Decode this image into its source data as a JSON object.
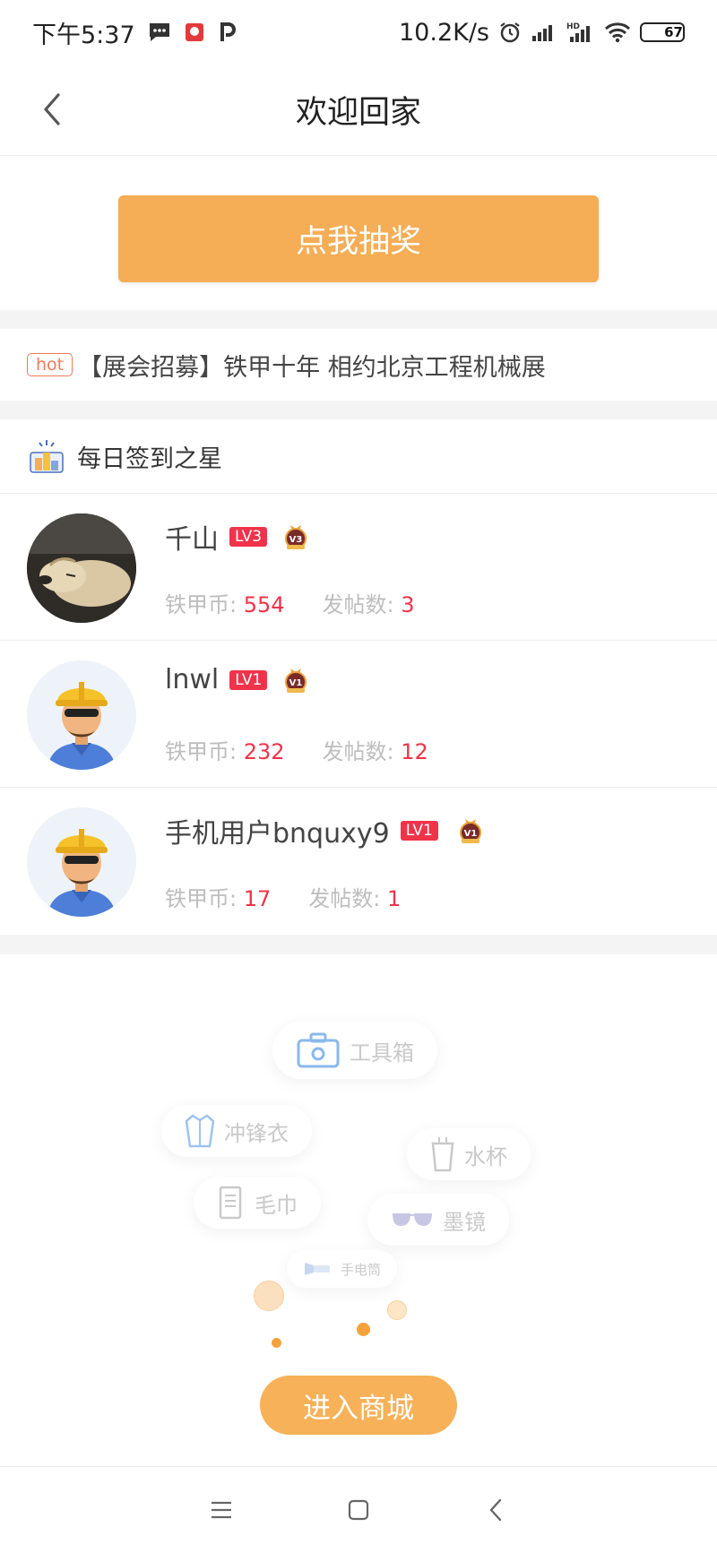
{
  "status_bar": {
    "time": "下午5:37",
    "net_speed": "10.2K/s",
    "battery_level": "67",
    "battery_fraction": 0.67,
    "icons": [
      "message-icon",
      "app-icon",
      "p-icon",
      "alarm-icon",
      "signal-icon",
      "hd-signal-icon",
      "wifi-icon",
      "battery-icon"
    ]
  },
  "header": {
    "title": "欢迎回家"
  },
  "lottery": {
    "button_label": "点我抽奖"
  },
  "hot_news": {
    "badge": "hot",
    "text": "【展会招募】铁甲十年 相约北京工程机械展"
  },
  "sign_in": {
    "title": "每日签到之星"
  },
  "users": [
    {
      "name": "千山",
      "level": "LV3",
      "coins_label": "铁甲币: ",
      "coins": "554",
      "posts_label": "发帖数: ",
      "posts": "3",
      "avatar": "dog-photo",
      "medal": "V3"
    },
    {
      "name": "lnwl",
      "level": "LV1",
      "coins_label": "铁甲币: ",
      "coins": "232",
      "posts_label": "发帖数: ",
      "posts": "12",
      "avatar": "worker-avatar",
      "medal": "V1"
    },
    {
      "name": "手机用户bnquxy9",
      "level": "LV1",
      "coins_label": "铁甲币: ",
      "coins": "17",
      "posts_label": "发帖数: ",
      "posts": "1",
      "avatar": "worker-avatar",
      "medal": "V1"
    }
  ],
  "mall": {
    "items": [
      {
        "label": "工具箱",
        "icon": "toolbox-icon"
      },
      {
        "label": "冲锋衣",
        "icon": "jacket-icon"
      },
      {
        "label": "水杯",
        "icon": "cup-icon"
      },
      {
        "label": "毛巾",
        "icon": "towel-icon"
      },
      {
        "label": "墨镜",
        "icon": "sunglasses-icon"
      },
      {
        "label": "手电筒",
        "icon": "flashlight-icon"
      }
    ],
    "button_label": "进入商城"
  },
  "colors": {
    "accent": "#f5ad56",
    "badge_red": "#f0334a",
    "hot": "#f37a5a"
  }
}
